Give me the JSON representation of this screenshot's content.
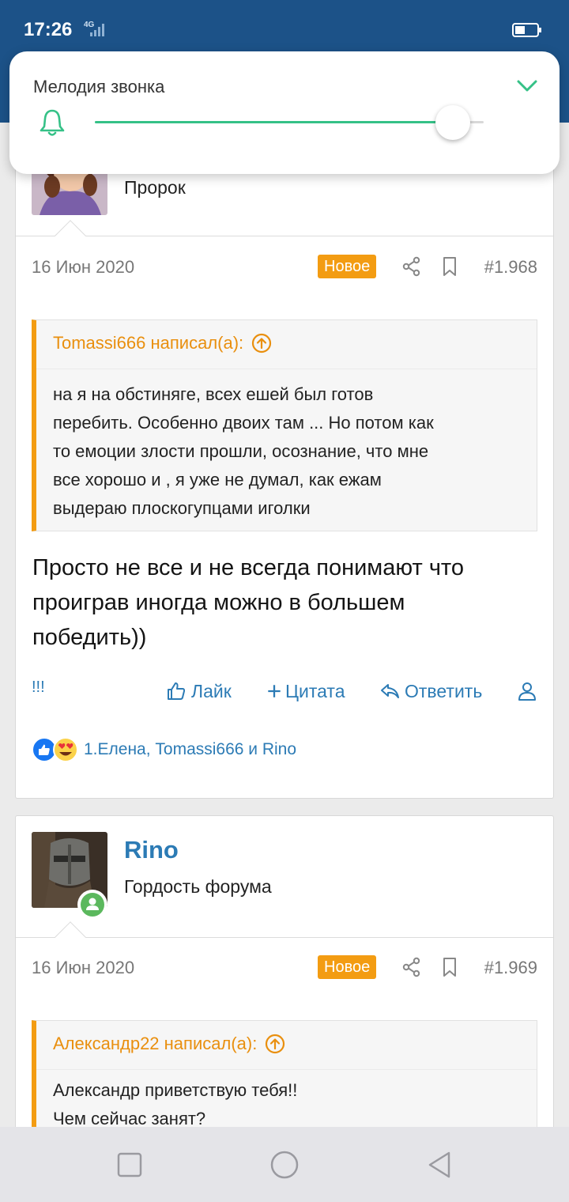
{
  "status_bar": {
    "time": "17:26",
    "network": "4G"
  },
  "volume_popup": {
    "title": "Мелодия звонка",
    "level": 0.92,
    "accent_color": "#35c187",
    "icons": {
      "bell": "bell-icon",
      "collapse": "chevron-down-icon"
    }
  },
  "posts": [
    {
      "user_title": "Пророк",
      "date": "16 Июн 2020",
      "badge": "Новое",
      "number": "#1.968",
      "quote": {
        "header": "Tomassi666 написал(а):",
        "lines": [
          "на я на обстиняге, всех ешей был готов",
          "перебить. Особенно двоих там ... Но потом как",
          "то емоции злости прошли, осознание, что мне",
          "все хорошо и , я уже не думал, как ежам",
          "выдераю плоскогупцами иголки"
        ]
      },
      "text_lines": [
        "Просто не все и не всегда понимают что",
        "проиграв иногда можно в большем",
        "победить))"
      ],
      "report": "!!!",
      "actions": {
        "like": "Лайк",
        "quote": "Цитата",
        "reply": "Ответить"
      },
      "reactions_text": "1.Елена, Tomassi666 и Rino"
    },
    {
      "username": "Rino",
      "user_title": "Гордость форума",
      "date": "16 Июн 2020",
      "badge": "Новое",
      "number": "#1.969",
      "quote": {
        "header": "Александр22 написал(а):",
        "lines": [
          "Александр приветствую тебя!!",
          "Чем сейчас занят?"
        ]
      }
    }
  ],
  "colors": {
    "brand": "#1c5288",
    "link": "#2c7bb5",
    "badge": "#f39c12",
    "quote_header": "#e98f0e"
  }
}
